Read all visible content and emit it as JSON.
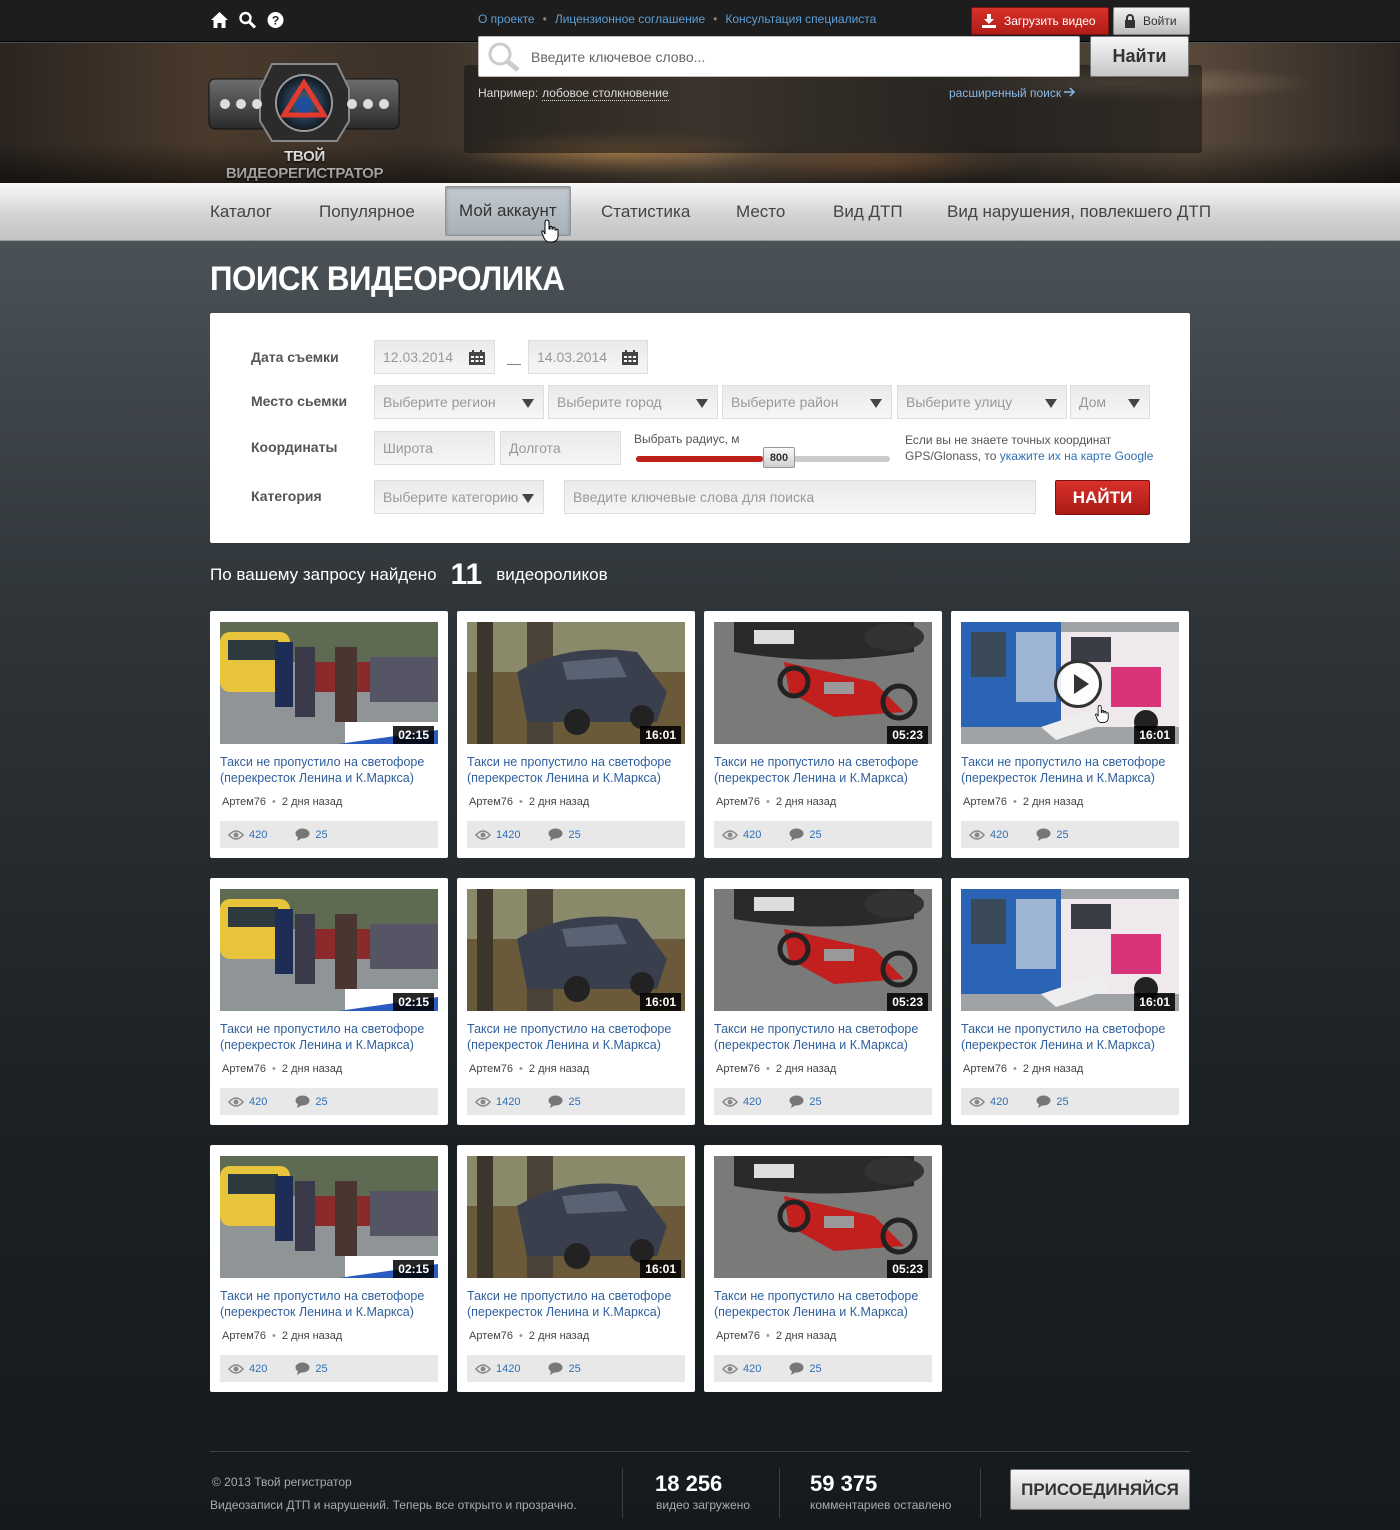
{
  "topbar": {
    "links": [
      "О проекте",
      "Лицензионное соглашение",
      "Консультация специалиста"
    ],
    "upload_label": "Загрузить видео",
    "login_label": "Войти"
  },
  "header": {
    "logo_text": "ТВОЙ ВИДЕОРЕГИСТРАТОР",
    "search_placeholder": "Введите ключевое слово...",
    "search_button": "Найти",
    "example_label": "Например:",
    "example_link": "лобовое столкновение",
    "advanced_search": "расширенный поиск"
  },
  "nav": {
    "items": [
      "Каталог",
      "Популярное",
      "Мой аккаунт",
      "Статистика",
      "Место",
      "Вид ДТП",
      "Вид нарушения, повлекшего ДТП"
    ],
    "active": "Мой аккаунт"
  },
  "page_title": "ПОИСК ВИДЕОРОЛИКА",
  "form": {
    "date_label": "Дата съемки",
    "date_from": "12.03.2014",
    "date_to": "14.03.2014",
    "place_label": "Место сьемки",
    "region_placeholder": "Выберите регион",
    "city_placeholder": "Выберите город",
    "district_placeholder": "Выберите район",
    "street_placeholder": "Выберите улицу",
    "house_placeholder": "Дом",
    "coords_label": "Координаты",
    "lat_placeholder": "Широта",
    "lon_placeholder": "Долгота",
    "radius_label": "Выбрать радиус, м",
    "radius_value": "800",
    "radius_fraction": 0.5,
    "coords_help": "Если вы не знаете точных координат GPS/Glonass, то",
    "coords_help_link": "укажите их на карте Google",
    "category_label": "Категория",
    "category_placeholder": "Выберите категорию",
    "keywords_placeholder": "Введите ключевые слова для поиска",
    "find_button": "НАЙТИ"
  },
  "results": {
    "prefix": "По вашему запросу найдено",
    "count": "11",
    "suffix": "видеороликов"
  },
  "videos": [
    {
      "title": "Такси не пропустило на светофоре (перекресток Ленина и К.Маркса)",
      "author": "Артем76",
      "ago": "2 дня назад",
      "views": "420",
      "comments": "25",
      "duration": "02:15",
      "scene": "taxi"
    },
    {
      "title": "Такси не пропустило на светофоре (перекресток Ленина и К.Маркса)",
      "author": "Артем76",
      "ago": "2 дня назад",
      "views": "1420",
      "comments": "25",
      "duration": "16:01",
      "scene": "tree"
    },
    {
      "title": "Такси не пропустило на светофоре (перекресток Ленина и К.Маркса)",
      "author": "Артем76",
      "ago": "2 дня назад",
      "views": "420",
      "comments": "25",
      "duration": "05:23",
      "scene": "moto"
    },
    {
      "title": "Такси не пропустило на светофоре (перекресток Ленина и К.Маркса)",
      "author": "Артем76",
      "ago": "2 дня назад",
      "views": "420",
      "comments": "25",
      "duration": "16:01",
      "scene": "bus",
      "hover": true
    },
    {
      "title": "Такси не пропустило на светофоре (перекресток Ленина и К.Маркса)",
      "author": "Артем76",
      "ago": "2 дня назад",
      "views": "420",
      "comments": "25",
      "duration": "02:15",
      "scene": "taxi"
    },
    {
      "title": "Такси не пропустило на светофоре (перекресток Ленина и К.Маркса)",
      "author": "Артем76",
      "ago": "2 дня назад",
      "views": "1420",
      "comments": "25",
      "duration": "16:01",
      "scene": "tree"
    },
    {
      "title": "Такси не пропустило на светофоре (перекресток Ленина и К.Маркса)",
      "author": "Артем76",
      "ago": "2 дня назад",
      "views": "420",
      "comments": "25",
      "duration": "05:23",
      "scene": "moto"
    },
    {
      "title": "Такси не пропустило на светофоре (перекресток Ленина и К.Маркса)",
      "author": "Артем76",
      "ago": "2 дня назад",
      "views": "420",
      "comments": "25",
      "duration": "16:01",
      "scene": "bus"
    },
    {
      "title": "Такси не пропустило на светофоре (перекресток Ленина и К.Маркса)",
      "author": "Артем76",
      "ago": "2 дня назад",
      "views": "420",
      "comments": "25",
      "duration": "02:15",
      "scene": "taxi"
    },
    {
      "title": "Такси не пропустило на светофоре (перекресток Ленина и К.Маркса)",
      "author": "Артем76",
      "ago": "2 дня назад",
      "views": "1420",
      "comments": "25",
      "duration": "16:01",
      "scene": "tree"
    },
    {
      "title": "Такси не пропустило на светофоре (перекресток Ленина и К.Маркса)",
      "author": "Артем76",
      "ago": "2 дня назад",
      "views": "420",
      "comments": "25",
      "duration": "05:23",
      "scene": "moto"
    }
  ],
  "footer": {
    "copyright": "©  2013  Твой регистратор",
    "tagline": "Видеозаписи ДТП и нарушений. Теперь все открыто и прозрачно.",
    "videos_count": "18 256",
    "videos_label": "видео загружено",
    "comments_count": "59 375",
    "comments_label": "комментариев оставлено",
    "join_button": "ПРИСОЕДИНЯЙСЯ"
  },
  "colors": {
    "accent_red": "#c0201a",
    "link_blue": "#2f6fb5",
    "card_title": "#2f5f9c"
  }
}
